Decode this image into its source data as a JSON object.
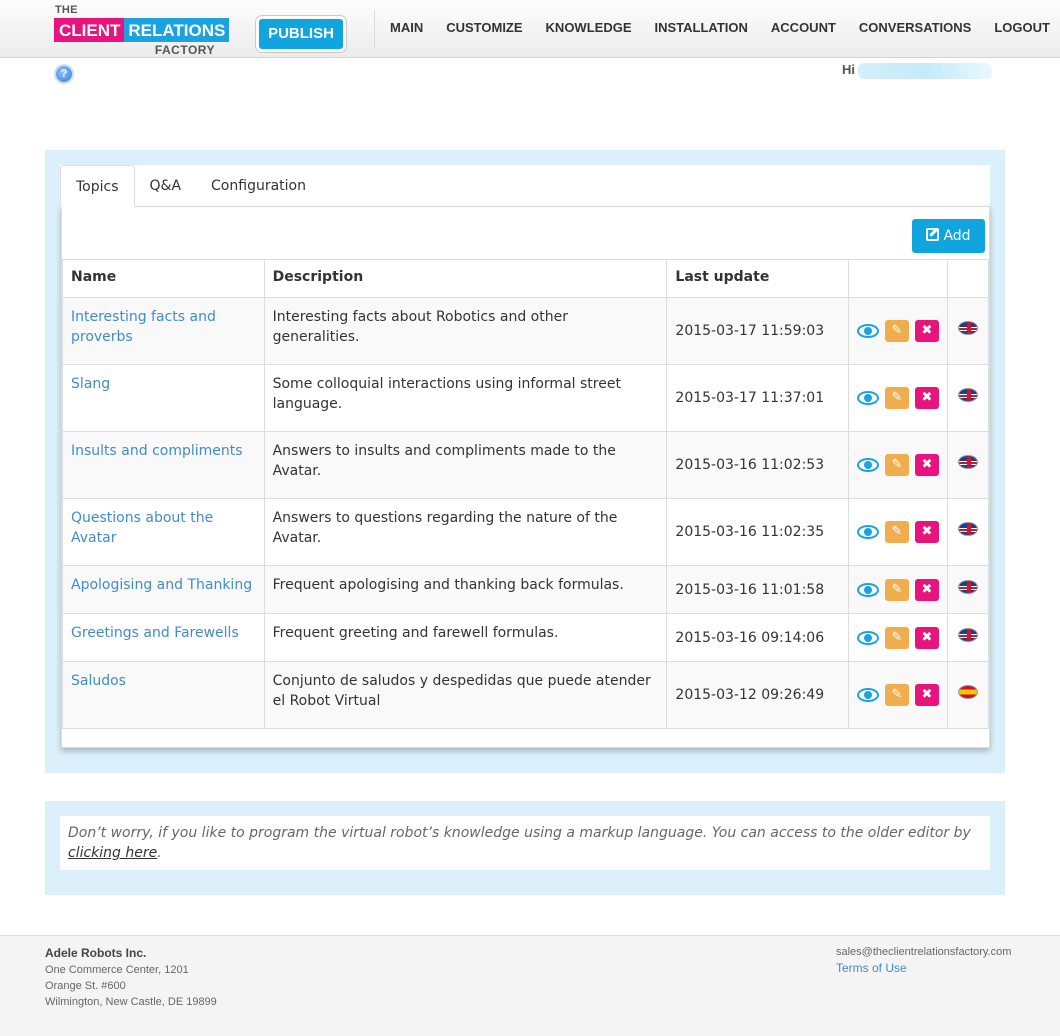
{
  "header": {
    "logo": {
      "the": "THE",
      "client": "CLIENT",
      "relations": "RELATIONS",
      "factory": "FACTORY"
    },
    "publish_label": "PUBLISH",
    "nav": [
      "MAIN",
      "CUSTOMIZE",
      "KNOWLEDGE",
      "INSTALLATION",
      "ACCOUNT",
      "CONVERSATIONS",
      "LOGOUT"
    ],
    "help_icon": "?",
    "greeting": "Hi"
  },
  "tabs": [
    "Topics",
    "Q&A",
    "Configuration"
  ],
  "active_tab": "Topics",
  "add_label": "Add",
  "table": {
    "columns": [
      "Name",
      "Description",
      "Last update",
      "",
      ""
    ],
    "rows": [
      {
        "name": "Interesting facts and proverbs",
        "description": "Interesting facts about Robotics and other generalities.",
        "updated": "2015-03-17 11:59:03",
        "flag": "uk-flag-icon"
      },
      {
        "name": "Slang",
        "description": "Some colloquial interactions using informal street language.",
        "updated": "2015-03-17 11:37:01",
        "flag": "uk-flag-icon"
      },
      {
        "name": "Insults and compliments",
        "description": "Answers to insults and compliments made to the Avatar.",
        "updated": "2015-03-16 11:02:53",
        "flag": "uk-flag-icon"
      },
      {
        "name": "Questions about the Avatar",
        "description": "Answers to questions regarding the nature of the Avatar.",
        "updated": "2015-03-16 11:02:35",
        "flag": "uk-flag-icon"
      },
      {
        "name": "Apologising and Thanking",
        "description": "Frequent apologising and thanking back formulas.",
        "updated": "2015-03-16 11:01:58",
        "flag": "uk-flag-icon"
      },
      {
        "name": "Greetings and Farewells",
        "description": "Frequent greeting and farewell formulas.",
        "updated": "2015-03-16 09:14:06",
        "flag": "uk-flag-icon"
      },
      {
        "name": "Saludos",
        "description": "Conjunto de saludos y despedidas que puede atender el Robot Virtual",
        "updated": "2015-03-12 09:26:49",
        "flag": "spain-flag-icon"
      }
    ],
    "row_icons": {
      "view": "eye-icon",
      "edit": "✎",
      "delete": "✖"
    }
  },
  "notice": {
    "text": "Don’t worry, if you like to program the virtual robot’s knowledge using a markup language. You can access to the older editor by ",
    "link": "clicking here",
    "end": "."
  },
  "footer": {
    "company": "Adele Robots Inc.",
    "address": [
      "One Commerce Center, 1201",
      "Orange St. #600",
      "Wilmington, New Castle, DE 19899"
    ],
    "email": "sales@theclientrelationsfactory.com",
    "terms": "Terms of Use"
  },
  "colors": {
    "brand_pink": "#e8137d",
    "brand_blue": "#1ba3df",
    "edit_orange": "#f0ad4e",
    "link_blue": "#428bca",
    "panel_bg": "#dcf0fb"
  }
}
